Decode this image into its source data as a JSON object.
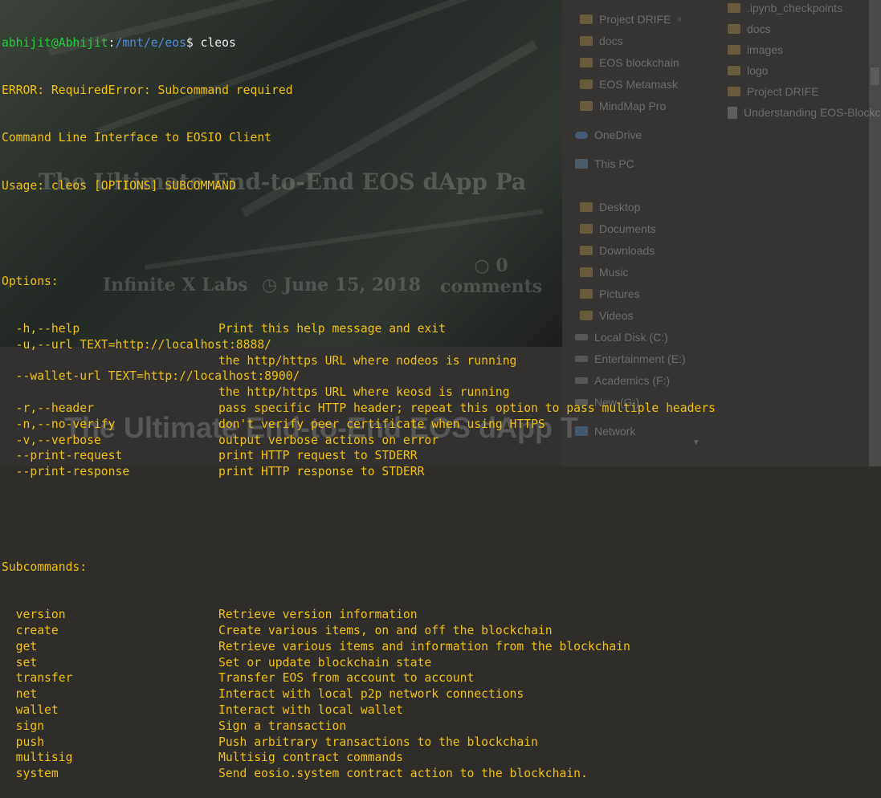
{
  "background": {
    "article_title_faint": "The Ultimate End-to-End EOS dApp Pa",
    "article_title_large": "The Ultimate End-to-End EOS dApp T",
    "meta_author": "Infinite X Labs",
    "meta_date": "June 15, 2018",
    "meta_comments_count": "0",
    "meta_comments_label": "comments",
    "explorer_nav": [
      {
        "label": "Project DRIFE",
        "icon": "folder-icon",
        "pinned": true
      },
      {
        "label": "docs",
        "icon": "folder-icon"
      },
      {
        "label": "EOS blockchain",
        "icon": "folder-icon"
      },
      {
        "label": "EOS Metamask",
        "icon": "folder-icon"
      },
      {
        "label": "MindMap Pro",
        "icon": "folder-icon"
      },
      {
        "label": "OneDrive",
        "icon": "cloud-icon"
      },
      {
        "label": "This PC",
        "icon": "computer-icon"
      },
      {
        "label": "Desktop",
        "icon": "folder-icon"
      },
      {
        "label": "Documents",
        "icon": "folder-icon"
      },
      {
        "label": "Downloads",
        "icon": "folder-icon"
      },
      {
        "label": "Music",
        "icon": "folder-icon"
      },
      {
        "label": "Pictures",
        "icon": "folder-icon"
      },
      {
        "label": "Videos",
        "icon": "folder-icon"
      },
      {
        "label": "Local Disk (C:)",
        "icon": "drive-icon"
      },
      {
        "label": "Entertainment (E:)",
        "icon": "drive-icon"
      },
      {
        "label": "Academics (F:)",
        "icon": "drive-icon"
      },
      {
        "label": "New (G:)",
        "icon": "drive-icon"
      },
      {
        "label": "Network",
        "icon": "network-icon"
      }
    ],
    "explorer_files": [
      {
        "label": ".ipynb_checkpoints",
        "icon": "folder-icon"
      },
      {
        "label": "docs",
        "icon": "folder-icon"
      },
      {
        "label": "images",
        "icon": "folder-icon"
      },
      {
        "label": "logo",
        "icon": "folder-icon"
      },
      {
        "label": "Project DRIFE",
        "icon": "folder-icon"
      },
      {
        "label": "Understanding EOS-Blockc",
        "icon": "document-icon"
      }
    ]
  },
  "terminal": {
    "prompt_user": "abhijit@Abhijit",
    "prompt_sep": ":",
    "prompt_path": "/mnt/e/eos",
    "prompt_symbol": "$ ",
    "command": "cleos",
    "lines": [
      "ERROR: RequiredError: Subcommand required",
      "Command Line Interface to EOSIO Client",
      "Usage: cleos [OPTIONS] SUBCOMMAND"
    ],
    "options_header": "Options:",
    "options": [
      {
        "flag": "  -h,--help",
        "desc": "Print this help message and exit"
      },
      {
        "flag": "  -u,--url TEXT=http://localhost:8888/",
        "desc": ""
      },
      {
        "flag": "",
        "desc": "the http/https URL where nodeos is running"
      },
      {
        "flag": "  --wallet-url TEXT=http://localhost:8900/",
        "desc": ""
      },
      {
        "flag": "",
        "desc": "the http/https URL where keosd is running"
      },
      {
        "flag": "  -r,--header",
        "desc": "pass specific HTTP header; repeat this option to pass multiple headers"
      },
      {
        "flag": "  -n,--no-verify",
        "desc": "don't verify peer certificate when using HTTPS"
      },
      {
        "flag": "  -v,--verbose",
        "desc": "output verbose actions on error"
      },
      {
        "flag": "  --print-request",
        "desc": "print HTTP request to STDERR"
      },
      {
        "flag": "  --print-response",
        "desc": "print HTTP response to STDERR"
      }
    ],
    "subcommands_header": "Subcommands:",
    "subcommands": [
      {
        "name": "  version",
        "desc": "Retrieve version information"
      },
      {
        "name": "  create",
        "desc": "Create various items, on and off the blockchain"
      },
      {
        "name": "  get",
        "desc": "Retrieve various items and information from the blockchain"
      },
      {
        "name": "  set",
        "desc": "Set or update blockchain state"
      },
      {
        "name": "  transfer",
        "desc": "Transfer EOS from account to account"
      },
      {
        "name": "  net",
        "desc": "Interact with local p2p network connections"
      },
      {
        "name": "  wallet",
        "desc": "Interact with local wallet"
      },
      {
        "name": "  sign",
        "desc": "Sign a transaction"
      },
      {
        "name": "  push",
        "desc": "Push arbitrary transactions to the blockchain"
      },
      {
        "name": "  multisig",
        "desc": "Multisig contract commands"
      },
      {
        "name": "  system",
        "desc": "Send eosio.system contract action to the blockchain."
      }
    ]
  },
  "colors": {
    "terminal_text": "#f0c10f",
    "prompt_user": "#22d33b",
    "prompt_path": "#4b8fe0",
    "command_text": "#f0f0f0"
  }
}
